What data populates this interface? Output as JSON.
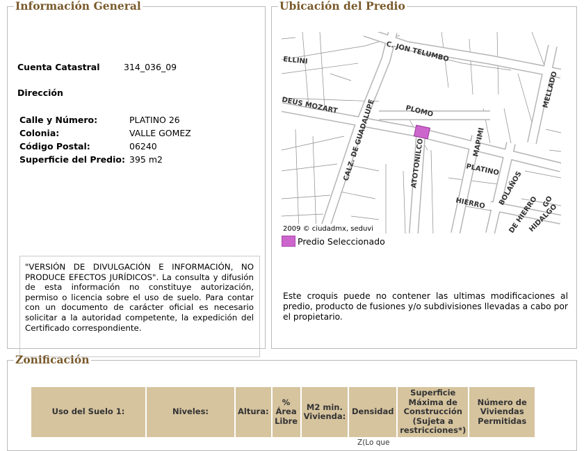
{
  "general": {
    "legend": "Información General",
    "cuenta_label": "Cuenta Catastral",
    "cuenta_value": "314_036_09",
    "direccion_label": "Dirección",
    "fields": [
      {
        "label": "Calle y Número:",
        "value": "PLATINO 26"
      },
      {
        "label": "Colonia:",
        "value": "VALLE GOMEZ"
      },
      {
        "label": "Código Postal:",
        "value": "06240"
      },
      {
        "label": "Superficie del Predio:",
        "value": "395 m2"
      }
    ],
    "disclaimer": "\"VERSIÓN DE DIVULGACIÓN E INFORMACIÓN, NO PRODUCE EFECTOS JURÍDICOS\". La consulta y difusión de esta información no constituye autorización, permiso o licencia sobre el uso de suelo. Para contar con un documento de carácter oficial es necesario solicitar a la autoridad competente, la expedición del Certificado correspondiente."
  },
  "ubicacion": {
    "legend": "Ubicación del Predio",
    "map_labels": {
      "telumbo": "C. JON TELUMBO",
      "bellini": "ELLINI",
      "mozart": "DEUS MOZART",
      "mellado": "MELLADO",
      "plomo": "PLOMO",
      "guadalupe": "CALZ. DE GUADALUPE",
      "atotonilco": "ATOTONILCO",
      "mapimi": "MAPIMI",
      "platino": "PLATINO",
      "bolanos": "BOLAÑOS",
      "hierro": "HIERRO",
      "de_hierro": "DE HIERRO",
      "hidalgo": "HIDALGO",
      "go": "GO",
      "copyright": "2009 © ciudadmx, seduvi"
    },
    "legend_item": "Predio Seleccionado",
    "highlight_color": "#cc66cc",
    "note": "Este croquis puede no contener las ultimas modificaciones al predio, producto de fusiones y/o subdivisiones llevadas a cabo por el propietario."
  },
  "zonificacion": {
    "legend": "Zonificación",
    "headers": [
      "Uso del Suelo 1:",
      "Niveles:",
      "Altura:",
      "% Área Libre",
      "M2 min. Vivienda:",
      "Densidad",
      "Superficie Máxima de Construcción (Sujeta a restricciones*)",
      "Número de Viviendas Permitidas"
    ],
    "partial_row": "Z(Lo que"
  }
}
